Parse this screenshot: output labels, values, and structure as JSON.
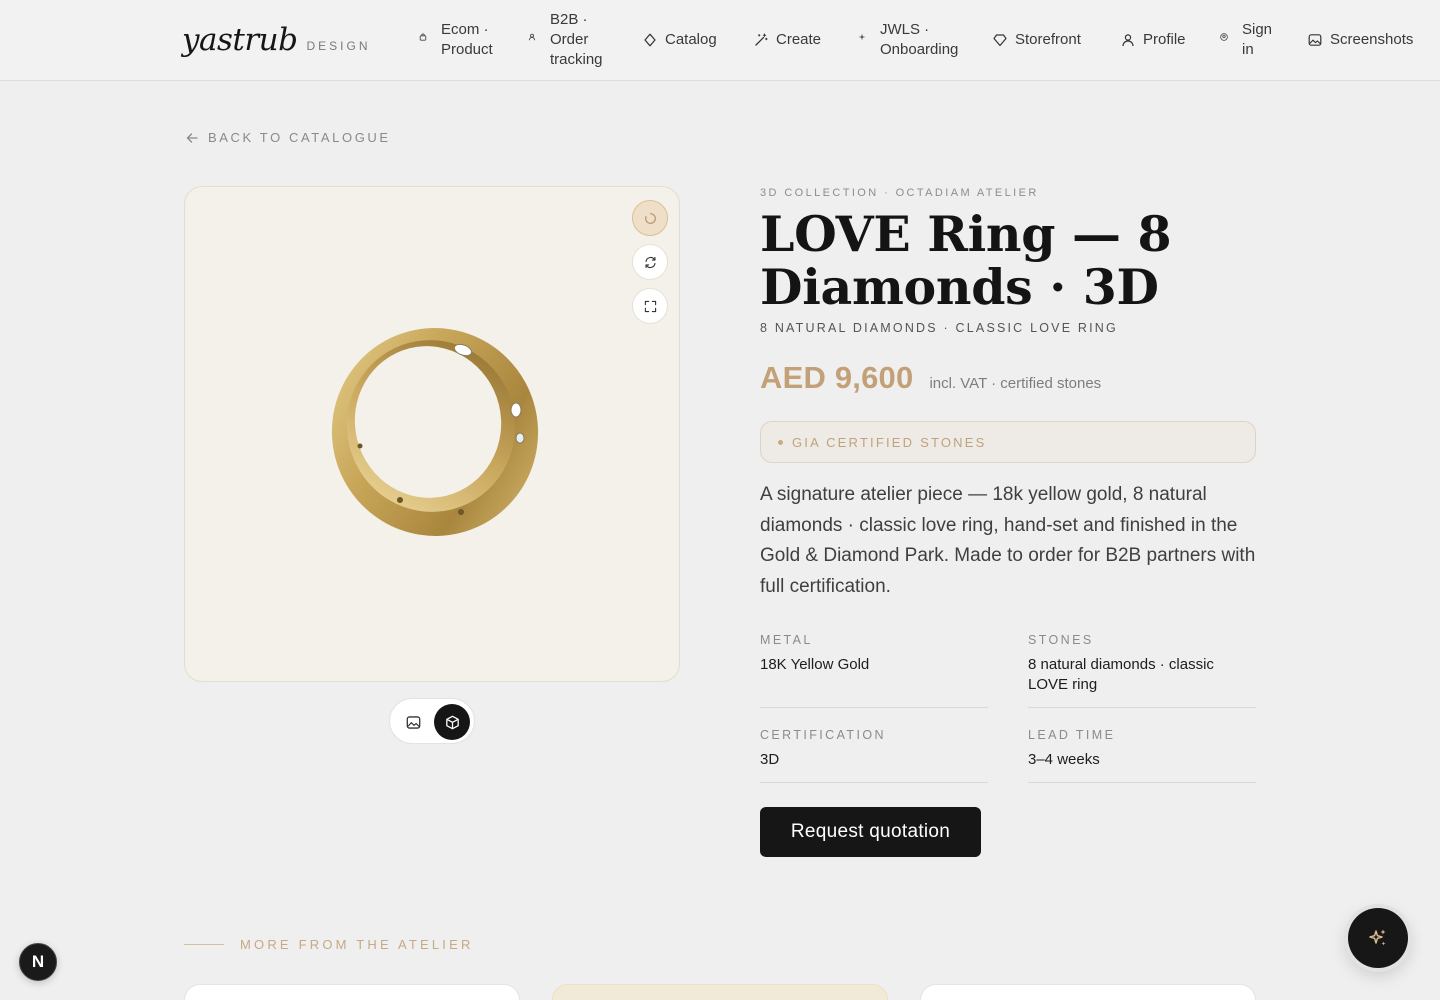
{
  "header": {
    "logo_word": "yastrub",
    "logo_sub": "DESIGN",
    "nav": [
      {
        "label_1": "Ecom ·",
        "label_2": "Product",
        "icon": "bag-icon"
      },
      {
        "label_1": "B2B ·",
        "label_2": "Order",
        "label_3": "tracking",
        "icon": "user-small-icon"
      },
      {
        "label": "Catalog",
        "icon": "diamond-icon"
      },
      {
        "label": "Create",
        "icon": "wand-icon"
      },
      {
        "label_1": "JWLS ·",
        "label_2": "Onboarding",
        "icon": "sparkle-small-icon"
      },
      {
        "label": "Storefront",
        "icon": "gem-icon"
      },
      {
        "label": "Profile",
        "icon": "user-icon"
      },
      {
        "label_1": "Sign",
        "label_2": "in",
        "icon": "account-circle-icon"
      },
      {
        "label": "Screenshots",
        "icon": "image-icon"
      }
    ]
  },
  "back_link": "BACK TO CATALOGUE",
  "viewer": {
    "buttons": [
      "spinner-icon",
      "rotate-icon",
      "fullscreen-icon"
    ],
    "toggle": [
      "image-view-icon",
      "3d-cube-icon"
    ],
    "active_view": "3d"
  },
  "product": {
    "eyebrow": "3D COLLECTION · OCTADIAM ATELIER",
    "title_line1": "LOVE Ring — 8",
    "title_line2": "Diamonds · 3D",
    "subtitle": "8 NATURAL DIAMONDS · CLASSIC LOVE RING",
    "price": "AED 9,600",
    "price_note": "incl. VAT · certified stones",
    "badge": "GIA CERTIFIED STONES",
    "description": "A signature atelier piece — 18k yellow gold, 8 natural diamonds · classic love ring, hand-set and finished in the Gold & Diamond Park. Made to order for B2B partners with full certification.",
    "specs": [
      {
        "label": "METAL",
        "value": "18K Yellow Gold"
      },
      {
        "label": "STONES",
        "value": "8 natural diamonds · classic LOVE ring"
      },
      {
        "label": "CERTIFICATION",
        "value": "3D"
      },
      {
        "label": "LEAD TIME",
        "value": "3–4 weeks"
      }
    ],
    "cta": "Request quotation"
  },
  "more": {
    "label": "MORE FROM THE ATELIER"
  },
  "floating": {
    "dev_badge": "N",
    "assistant_icon": "sparkles-icon"
  },
  "colors": {
    "accent_gold": "#c3a178",
    "ink": "#161616",
    "background": "#efefef"
  }
}
